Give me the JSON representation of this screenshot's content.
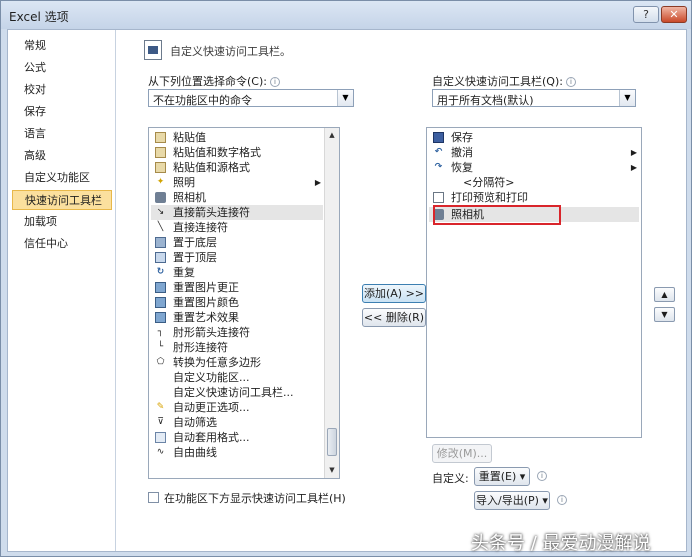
{
  "window": {
    "title": "Excel 选项",
    "help_icon": "?",
    "close_icon": "✕"
  },
  "sidebar": {
    "items": [
      {
        "label": "常规"
      },
      {
        "label": "公式"
      },
      {
        "label": "校对"
      },
      {
        "label": "保存"
      },
      {
        "label": "语言"
      },
      {
        "label": "高级"
      },
      {
        "label": "自定义功能区"
      },
      {
        "label": "快速访问工具栏",
        "selected": true
      },
      {
        "label": "加载项"
      },
      {
        "label": "信任中心"
      }
    ]
  },
  "header": {
    "text": "自定义快速访问工具栏。"
  },
  "left_panel": {
    "label": "从下列位置选择命令(C):",
    "combo_value": "不在功能区中的命令",
    "commands": [
      {
        "label": "粘贴值",
        "icon": "paste-icon"
      },
      {
        "label": "粘贴值和数字格式",
        "icon": "paste-icon"
      },
      {
        "label": "粘贴值和源格式",
        "icon": "paste-icon"
      },
      {
        "label": "照明",
        "icon": "lighting-icon",
        "submenu": true
      },
      {
        "label": "照相机",
        "icon": "camera-icon"
      },
      {
        "label": "直接箭头连接符",
        "icon": "arrow-connector-icon",
        "selected": true
      },
      {
        "label": "直接连接符",
        "icon": "line-connector-icon"
      },
      {
        "label": "置于底层",
        "icon": "send-back-icon"
      },
      {
        "label": "置于顶层",
        "icon": "bring-front-icon"
      },
      {
        "label": "重复",
        "icon": "repeat-icon"
      },
      {
        "label": "重置图片更正",
        "icon": "reset-picture-icon"
      },
      {
        "label": "重置图片颜色",
        "icon": "reset-color-icon"
      },
      {
        "label": "重置艺术效果",
        "icon": "reset-art-icon"
      },
      {
        "label": "肘形箭头连接符",
        "icon": "elbow-arrow-icon"
      },
      {
        "label": "肘形连接符",
        "icon": "elbow-connector-icon"
      },
      {
        "label": "转换为任意多边形",
        "icon": "freeform-icon"
      },
      {
        "label": "自定义功能区...",
        "icon": ""
      },
      {
        "label": "自定义快速访问工具栏...",
        "icon": ""
      },
      {
        "label": "自动更正选项...",
        "icon": "autocorrect-icon"
      },
      {
        "label": "自动筛选",
        "icon": "filter-icon"
      },
      {
        "label": "自动套用格式...",
        "icon": "autoformat-icon"
      },
      {
        "label": "自由曲线",
        "icon": "freeform-curve-icon"
      }
    ],
    "checkbox_label": "在功能区下方显示快速访问工具栏(H)"
  },
  "right_panel": {
    "label": "自定义快速访问工具栏(Q):",
    "combo_value": "用于所有文档(默认)",
    "items": [
      {
        "label": "保存",
        "icon": "save-icon"
      },
      {
        "label": "撤消",
        "icon": "undo-icon",
        "submenu": true
      },
      {
        "label": "恢复",
        "icon": "redo-icon",
        "submenu": true
      },
      {
        "label": "<分隔符>",
        "icon": ""
      },
      {
        "label": "打印预览和打印",
        "icon": "print-preview-icon"
      },
      {
        "label": "照相机",
        "icon": "camera-icon",
        "selected": true
      }
    ],
    "modify_label": "修改(M)...",
    "customize_label": "自定义:",
    "reset_label": "重置(E) ▾",
    "import_export_label": "导入/导出(P) ▾"
  },
  "buttons": {
    "add": "添加(A) >>",
    "remove": "<< 删除(R)"
  },
  "watermark": "头条号 / 最爱动漫解说",
  "colors": {
    "selection": "#fbe09e",
    "highlight_box": "#d9252b",
    "window_bg": "#cfdcec"
  }
}
